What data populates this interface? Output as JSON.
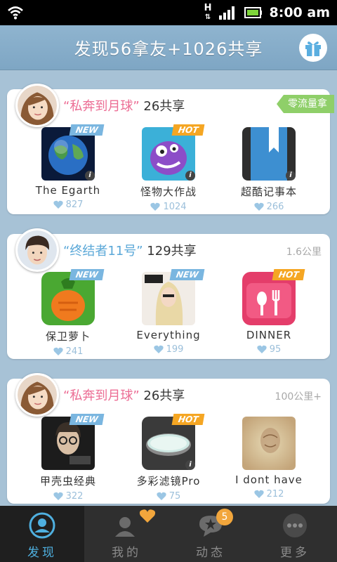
{
  "status_bar": {
    "time": "8:00 am",
    "network": "H"
  },
  "header": {
    "title": "发现56拿友+1026共享",
    "gift_icon": "gift-icon"
  },
  "cards": [
    {
      "nick": "“私奔到月球”",
      "count": "26共享",
      "tag": "零流量拿",
      "apps": [
        {
          "name": "The Egarth",
          "likes": "827",
          "badge": "NEW"
        },
        {
          "name": "怪物大作战",
          "likes": "1024",
          "badge": "HOT"
        },
        {
          "name": "超酷记事本",
          "likes": "266",
          "badge": ""
        }
      ]
    },
    {
      "nick": "“终结者11号”",
      "count": "129共享",
      "distance": "1.6公里",
      "apps": [
        {
          "name": "保卫萝卜",
          "likes": "241",
          "badge": "NEW"
        },
        {
          "name": "Everything",
          "likes": "199",
          "badge": "NEW"
        },
        {
          "name": "DINNER",
          "likes": "95",
          "badge": "HOT"
        }
      ]
    },
    {
      "nick": "“私奔到月球”",
      "count": "26共享",
      "distance": "100公里+",
      "apps": [
        {
          "name": "甲壳虫经典",
          "likes": "322",
          "badge": "NEW"
        },
        {
          "name": "多彩滤镜Pro",
          "likes": "75",
          "badge": "HOT"
        },
        {
          "name": "I dont have",
          "likes": "212",
          "badge": ""
        }
      ]
    }
  ],
  "tabs": [
    {
      "label": "发现",
      "icon": "discover-icon",
      "active": true
    },
    {
      "label": "我的",
      "icon": "profile-icon"
    },
    {
      "label": "动态",
      "icon": "chat-bubble-icon",
      "badge": "5"
    },
    {
      "label": "更多",
      "icon": "more-icon"
    }
  ],
  "colors": {
    "accent_blue": "#4fb0e0",
    "nick_pink": "#ec6d94",
    "nick_blue": "#5ba8d8",
    "hot": "#f5a623",
    "new": "#7ab6e0",
    "tag_green": "#8fcf69"
  }
}
